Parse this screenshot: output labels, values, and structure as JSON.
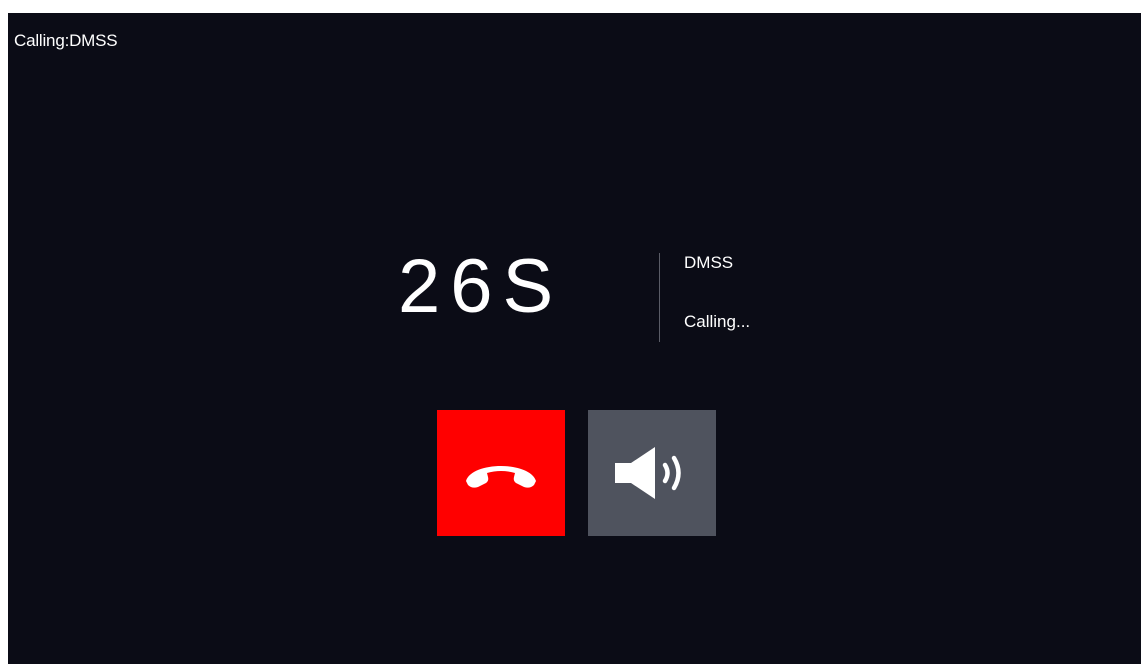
{
  "header": {
    "title": "Calling:DMSS"
  },
  "call": {
    "timer": "26S",
    "caller": "DMSS",
    "status": "Calling..."
  },
  "controls": {
    "hangup_icon": "phone-hangup-icon",
    "speaker_icon": "speaker-volume-icon",
    "hangup_color": "#ff0000",
    "speaker_color": "#4f535e"
  }
}
